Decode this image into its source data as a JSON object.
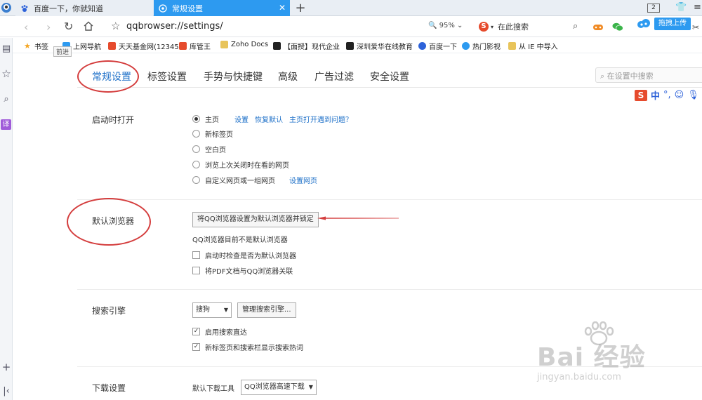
{
  "tabs": [
    {
      "title": "百度一下，你就知道",
      "active": false
    },
    {
      "title": "常规设置",
      "active": true
    }
  ],
  "tab_count": "2",
  "toolbar": {
    "url": "qqbrowser://settings/",
    "zoom": "95%",
    "search_placeholder": "在此搜索",
    "upload_label": "拖拽上传"
  },
  "bookmarks": [
    {
      "label": "书签",
      "icon": "star-icon",
      "color": "#f5a623"
    },
    {
      "label": "上网导航",
      "icon": "nav-icon",
      "color": "#2d9af0"
    },
    {
      "label": "天天基金网(12345",
      "icon": "fund-icon",
      "color": "#e64b2d"
    },
    {
      "label": "库管王",
      "icon": "shop-icon",
      "color": "#e64b2d"
    },
    {
      "label": "Zoho Docs",
      "icon": "folder-icon",
      "color": "#e8c45a"
    },
    {
      "label": "【面授】现代企业",
      "icon": "edu-icon",
      "color": "#222"
    },
    {
      "label": "深圳爱华在线教育",
      "icon": "edu-icon",
      "color": "#222"
    },
    {
      "label": "百度一下",
      "icon": "baidu-icon",
      "color": "#2d62d9"
    },
    {
      "label": "热门影视",
      "icon": "video-icon",
      "color": "#2d9af0"
    },
    {
      "label": "从 IE 中导入",
      "icon": "folder-icon",
      "color": "#e8c45a"
    }
  ],
  "tooltip": "前进",
  "settings": {
    "nav": [
      "常规设置",
      "标签设置",
      "手势与快捷键",
      "高级",
      "广告过滤",
      "安全设置"
    ],
    "search_placeholder": "在设置中搜索",
    "startup": {
      "title": "启动时打开",
      "options": [
        "主页",
        "新标签页",
        "空白页",
        "浏览上次关闭时在看的网页",
        "自定义网页或一组网页"
      ],
      "links": [
        "设置",
        "恢复默认",
        "主页打开遇到问题？"
      ],
      "custom_link": "设置网页"
    },
    "default_browser": {
      "title": "默认浏览器",
      "button": "将QQ浏览器设置为默认浏览器并锁定",
      "status": "QQ浏览器目前不是默认浏览器",
      "check1": "启动时检查是否为默认浏览器",
      "check2": "将PDF文档与QQ浏览器关联"
    },
    "search_engine": {
      "title": "搜索引擎",
      "selected": "搜狗",
      "manage_button": "管理搜索引擎...",
      "check1": "启用搜索直达",
      "check2": "新标签页和搜索栏显示搜索热词"
    },
    "download": {
      "title": "下载设置",
      "label": "默认下载工具",
      "selected": "QQ浏览器高速下载"
    }
  },
  "ime": {
    "label": "中"
  },
  "watermark": {
    "main": "Bai 经验",
    "sub": "jingyan.baidu.com"
  },
  "colors": {
    "accent": "#2d9af0",
    "link": "#1e70c8",
    "annotation": "#d43d3d"
  }
}
